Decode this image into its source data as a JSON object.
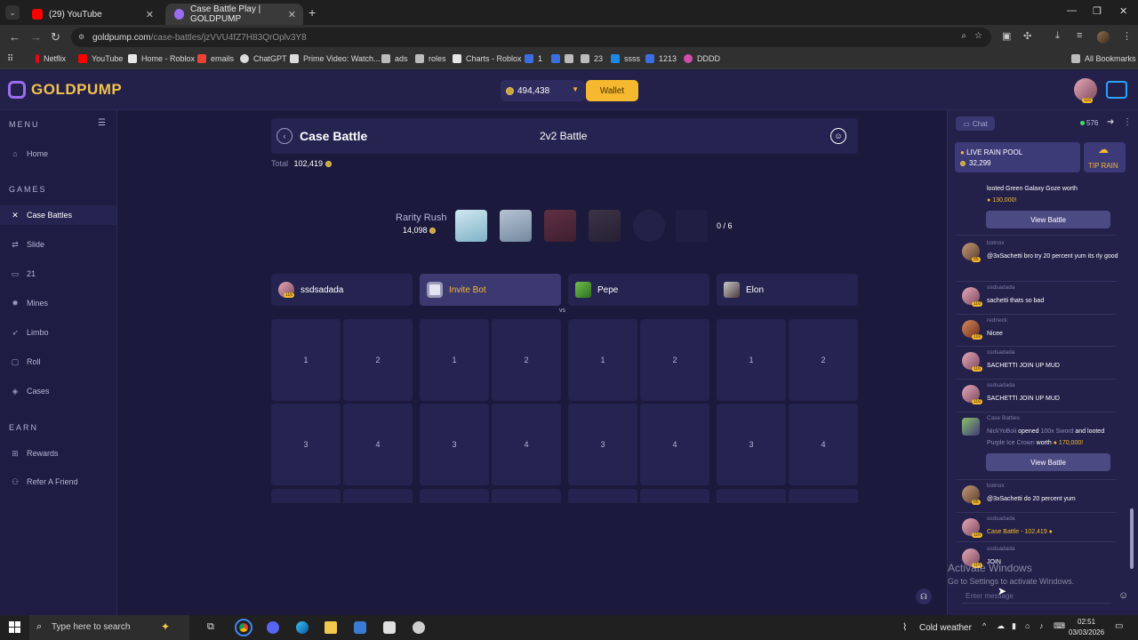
{
  "browser": {
    "tabs": [
      {
        "title": "(29) YouTube",
        "active": false
      },
      {
        "title": "Case Battle Play | GOLDPUMP",
        "active": true
      }
    ],
    "url_domain": "goldpump.com",
    "url_path": "/case-battles/jzVVU4fZ7H83QrOplv3Y8",
    "bookmarks": [
      "Netflix",
      "YouTube",
      "Home - Roblox",
      "emails",
      "ChatGPT",
      "Prime Video: Watch...",
      "ads",
      "roles",
      "Charts - Roblox",
      "1",
      "",
      "23",
      "ssss",
      "1213",
      "DDDD"
    ],
    "all_bookmarks": "All Bookmarks"
  },
  "header": {
    "logo": "GOLDPUMP",
    "balance": "494,438",
    "wallet_label": "Wallet"
  },
  "sidebar": {
    "menu_label": "MENU",
    "sections": [
      {
        "title": "GAMES"
      },
      {
        "title": "EARN"
      }
    ],
    "items": [
      {
        "label": "Home",
        "icon": "home-icon"
      },
      {
        "label": "Case Battles",
        "icon": "swords-icon",
        "active": true
      },
      {
        "label": "Slide",
        "icon": "slide-icon"
      },
      {
        "label": "21",
        "icon": "cards-icon"
      },
      {
        "label": "Mines",
        "icon": "mine-icon"
      },
      {
        "label": "Limbo",
        "icon": "rocket-icon"
      },
      {
        "label": "Roll",
        "icon": "dice-icon"
      },
      {
        "label": "Cases",
        "icon": "box-icon"
      },
      {
        "label": "Rewards",
        "icon": "gift-icon"
      },
      {
        "label": "Refer A Friend",
        "icon": "user-plus-icon"
      }
    ]
  },
  "battle": {
    "title": "Case Battle",
    "mode": "2v2 Battle",
    "total_label": "Total",
    "total_value": "102,419",
    "case_name": "Rarity Rush",
    "case_value": "14,098",
    "round_progress": "0 / 6",
    "vs_label": "vs",
    "players": [
      {
        "name": "ssdsadada",
        "level": "116"
      },
      {
        "name": "Invite Bot",
        "level": ""
      },
      {
        "name": "Pepe",
        "level": ""
      },
      {
        "name": "Elon",
        "level": ""
      }
    ],
    "slot_row1": [
      "1",
      "2",
      "1",
      "2",
      "1",
      "2",
      "1",
      "2"
    ],
    "slot_row2": [
      "3",
      "4",
      "3",
      "4",
      "3",
      "4",
      "3",
      "4"
    ]
  },
  "chat": {
    "chat_label": "Chat",
    "online_count": "576",
    "rain_title": "LIVE RAIN POOL",
    "rain_value": "32,299",
    "tip_rain": "TIP RAIN",
    "input_placeholder": "Enter message",
    "view_battle": "View Battle",
    "messages": [
      {
        "user": "",
        "text": "looted Green Galaxy Goze worth",
        "amount": "130,000!",
        "level": "",
        "button": true
      },
      {
        "user": "botnox",
        "text": "@3xSachetti bro try 20 percent yum its rly good",
        "level": "85"
      },
      {
        "user": "ssdsadada",
        "text": "sachetti thats so bad",
        "level": "116"
      },
      {
        "user": "redneck",
        "text": "Nicee",
        "level": "102"
      },
      {
        "user": "ssdsadada",
        "text": "SACHETTI JOIN UP MUD",
        "level": "116"
      },
      {
        "user": "ssdsadada",
        "text": "SACHETTI JOIN UP MUD",
        "level": "116"
      },
      {
        "user": "Case Battles",
        "text_user": "NickYoBoii",
        "text_opened": "opened",
        "text_case": "100x Sword",
        "text_and": "and looted",
        "text_item": "Purple Ice Crown",
        "text_worth": "worth",
        "amount": "170,000!",
        "button": true
      },
      {
        "user": "botnox",
        "text": "@3xSachetti do 20 percent yum",
        "level": "85"
      },
      {
        "user": "ssdsadada",
        "text": "Case Battle - 102,419",
        "level": "116"
      },
      {
        "user": "ssdsadada",
        "text": "JOIN",
        "level": "116"
      }
    ],
    "watermark_line1": "Activate Windows",
    "watermark_line2": "Go to Settings to activate Windows."
  },
  "taskbar": {
    "search_placeholder": "Type here to search",
    "weather": "Cold weather",
    "time": "02:51",
    "date": "03/03/2026"
  }
}
